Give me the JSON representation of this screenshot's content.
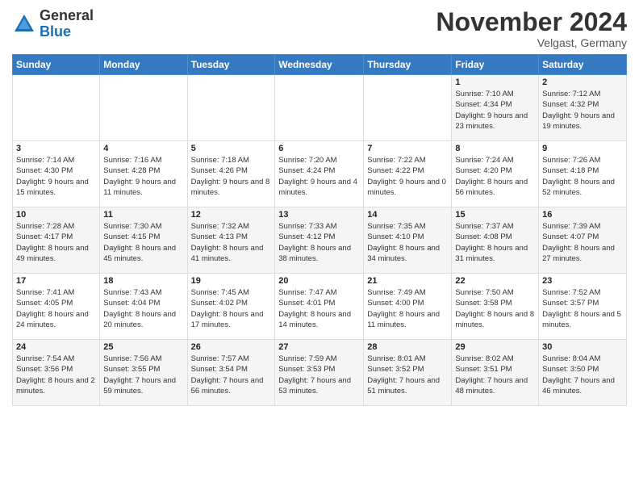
{
  "header": {
    "logo_general": "General",
    "logo_blue": "Blue",
    "month_title": "November 2024",
    "subtitle": "Velgast, Germany"
  },
  "days_of_week": [
    "Sunday",
    "Monday",
    "Tuesday",
    "Wednesday",
    "Thursday",
    "Friday",
    "Saturday"
  ],
  "weeks": [
    [
      {
        "day": "",
        "info": ""
      },
      {
        "day": "",
        "info": ""
      },
      {
        "day": "",
        "info": ""
      },
      {
        "day": "",
        "info": ""
      },
      {
        "day": "",
        "info": ""
      },
      {
        "day": "1",
        "info": "Sunrise: 7:10 AM\nSunset: 4:34 PM\nDaylight: 9 hours and 23 minutes."
      },
      {
        "day": "2",
        "info": "Sunrise: 7:12 AM\nSunset: 4:32 PM\nDaylight: 9 hours and 19 minutes."
      }
    ],
    [
      {
        "day": "3",
        "info": "Sunrise: 7:14 AM\nSunset: 4:30 PM\nDaylight: 9 hours and 15 minutes."
      },
      {
        "day": "4",
        "info": "Sunrise: 7:16 AM\nSunset: 4:28 PM\nDaylight: 9 hours and 11 minutes."
      },
      {
        "day": "5",
        "info": "Sunrise: 7:18 AM\nSunset: 4:26 PM\nDaylight: 9 hours and 8 minutes."
      },
      {
        "day": "6",
        "info": "Sunrise: 7:20 AM\nSunset: 4:24 PM\nDaylight: 9 hours and 4 minutes."
      },
      {
        "day": "7",
        "info": "Sunrise: 7:22 AM\nSunset: 4:22 PM\nDaylight: 9 hours and 0 minutes."
      },
      {
        "day": "8",
        "info": "Sunrise: 7:24 AM\nSunset: 4:20 PM\nDaylight: 8 hours and 56 minutes."
      },
      {
        "day": "9",
        "info": "Sunrise: 7:26 AM\nSunset: 4:18 PM\nDaylight: 8 hours and 52 minutes."
      }
    ],
    [
      {
        "day": "10",
        "info": "Sunrise: 7:28 AM\nSunset: 4:17 PM\nDaylight: 8 hours and 49 minutes."
      },
      {
        "day": "11",
        "info": "Sunrise: 7:30 AM\nSunset: 4:15 PM\nDaylight: 8 hours and 45 minutes."
      },
      {
        "day": "12",
        "info": "Sunrise: 7:32 AM\nSunset: 4:13 PM\nDaylight: 8 hours and 41 minutes."
      },
      {
        "day": "13",
        "info": "Sunrise: 7:33 AM\nSunset: 4:12 PM\nDaylight: 8 hours and 38 minutes."
      },
      {
        "day": "14",
        "info": "Sunrise: 7:35 AM\nSunset: 4:10 PM\nDaylight: 8 hours and 34 minutes."
      },
      {
        "day": "15",
        "info": "Sunrise: 7:37 AM\nSunset: 4:08 PM\nDaylight: 8 hours and 31 minutes."
      },
      {
        "day": "16",
        "info": "Sunrise: 7:39 AM\nSunset: 4:07 PM\nDaylight: 8 hours and 27 minutes."
      }
    ],
    [
      {
        "day": "17",
        "info": "Sunrise: 7:41 AM\nSunset: 4:05 PM\nDaylight: 8 hours and 24 minutes."
      },
      {
        "day": "18",
        "info": "Sunrise: 7:43 AM\nSunset: 4:04 PM\nDaylight: 8 hours and 20 minutes."
      },
      {
        "day": "19",
        "info": "Sunrise: 7:45 AM\nSunset: 4:02 PM\nDaylight: 8 hours and 17 minutes."
      },
      {
        "day": "20",
        "info": "Sunrise: 7:47 AM\nSunset: 4:01 PM\nDaylight: 8 hours and 14 minutes."
      },
      {
        "day": "21",
        "info": "Sunrise: 7:49 AM\nSunset: 4:00 PM\nDaylight: 8 hours and 11 minutes."
      },
      {
        "day": "22",
        "info": "Sunrise: 7:50 AM\nSunset: 3:58 PM\nDaylight: 8 hours and 8 minutes."
      },
      {
        "day": "23",
        "info": "Sunrise: 7:52 AM\nSunset: 3:57 PM\nDaylight: 8 hours and 5 minutes."
      }
    ],
    [
      {
        "day": "24",
        "info": "Sunrise: 7:54 AM\nSunset: 3:56 PM\nDaylight: 8 hours and 2 minutes."
      },
      {
        "day": "25",
        "info": "Sunrise: 7:56 AM\nSunset: 3:55 PM\nDaylight: 7 hours and 59 minutes."
      },
      {
        "day": "26",
        "info": "Sunrise: 7:57 AM\nSunset: 3:54 PM\nDaylight: 7 hours and 56 minutes."
      },
      {
        "day": "27",
        "info": "Sunrise: 7:59 AM\nSunset: 3:53 PM\nDaylight: 7 hours and 53 minutes."
      },
      {
        "day": "28",
        "info": "Sunrise: 8:01 AM\nSunset: 3:52 PM\nDaylight: 7 hours and 51 minutes."
      },
      {
        "day": "29",
        "info": "Sunrise: 8:02 AM\nSunset: 3:51 PM\nDaylight: 7 hours and 48 minutes."
      },
      {
        "day": "30",
        "info": "Sunrise: 8:04 AM\nSunset: 3:50 PM\nDaylight: 7 hours and 46 minutes."
      }
    ]
  ]
}
